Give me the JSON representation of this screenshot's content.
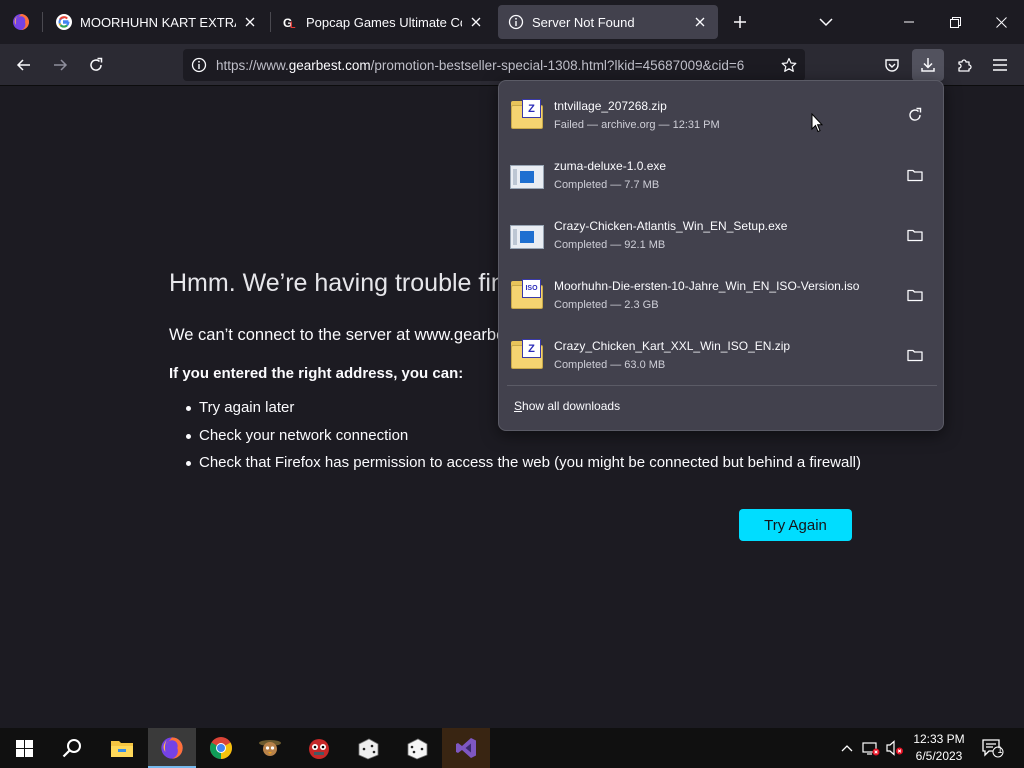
{
  "tabs": [
    {
      "title": "MOORHUHN KART EXTRA XXL",
      "favicon": "google-g-icon"
    },
    {
      "title": "Popcap Games Ultimate Collect",
      "favicon": "gl-site-icon"
    },
    {
      "title": "Server Not Found",
      "favicon": "info-icon",
      "active": true
    }
  ],
  "navbar": {
    "url_prefix": "https://www.",
    "url_domain": "gearbest.com",
    "url_path": "/promotion-bestseller-special-1308.html?lkid=45687009&cid=6"
  },
  "error_page": {
    "title": "Hmm. We’re having trouble finding that site.",
    "description": "We can’t connect to the server at www.gearbest.com.",
    "subheading": "If you entered the right address, you can:",
    "suggestions": [
      "Try again later",
      "Check your network connection",
      "Check that Firefox has permission to access the web (you might be connected but behind a firewall)"
    ],
    "try_again_label": "Try Again"
  },
  "downloads": {
    "items": [
      {
        "name": "tntvillage_207268.zip",
        "status": "Failed — archive.org — 12:31 PM",
        "file_icon": "zip-file-icon",
        "action_icon": "retry-icon"
      },
      {
        "name": "zuma-deluxe-1.0.exe",
        "status": "Completed — 7.7 MB",
        "file_icon": "exe-file-icon",
        "action_icon": "folder-icon"
      },
      {
        "name": "Crazy-Chicken-Atlantis_Win_EN_Setup.exe",
        "status": "Completed — 92.1 MB",
        "file_icon": "exe-file-icon",
        "action_icon": "folder-icon"
      },
      {
        "name": "Moorhuhn-Die-ersten-10-Jahre_Win_EN_ISO-Version.iso",
        "status": "Completed — 2.3 GB",
        "file_icon": "iso-file-icon",
        "action_icon": "folder-icon"
      },
      {
        "name": "Crazy_Chicken_Kart_XXL_Win_ISO_EN.zip",
        "status": "Completed — 63.0 MB",
        "file_icon": "zip-file-icon",
        "action_icon": "folder-icon"
      }
    ],
    "show_all_label_ul": "S",
    "show_all_label_rest": "how all downloads",
    "zip_badge": "Z",
    "iso_badge": "ISO"
  },
  "taskbar": {
    "time": "12:33 PM",
    "date": "6/5/2023",
    "notification_count": "1"
  },
  "colors": {
    "accent_button": "#00ddff",
    "background": "#1c1b22",
    "toolbar": "#2b2a33",
    "panel": "#42414d"
  }
}
